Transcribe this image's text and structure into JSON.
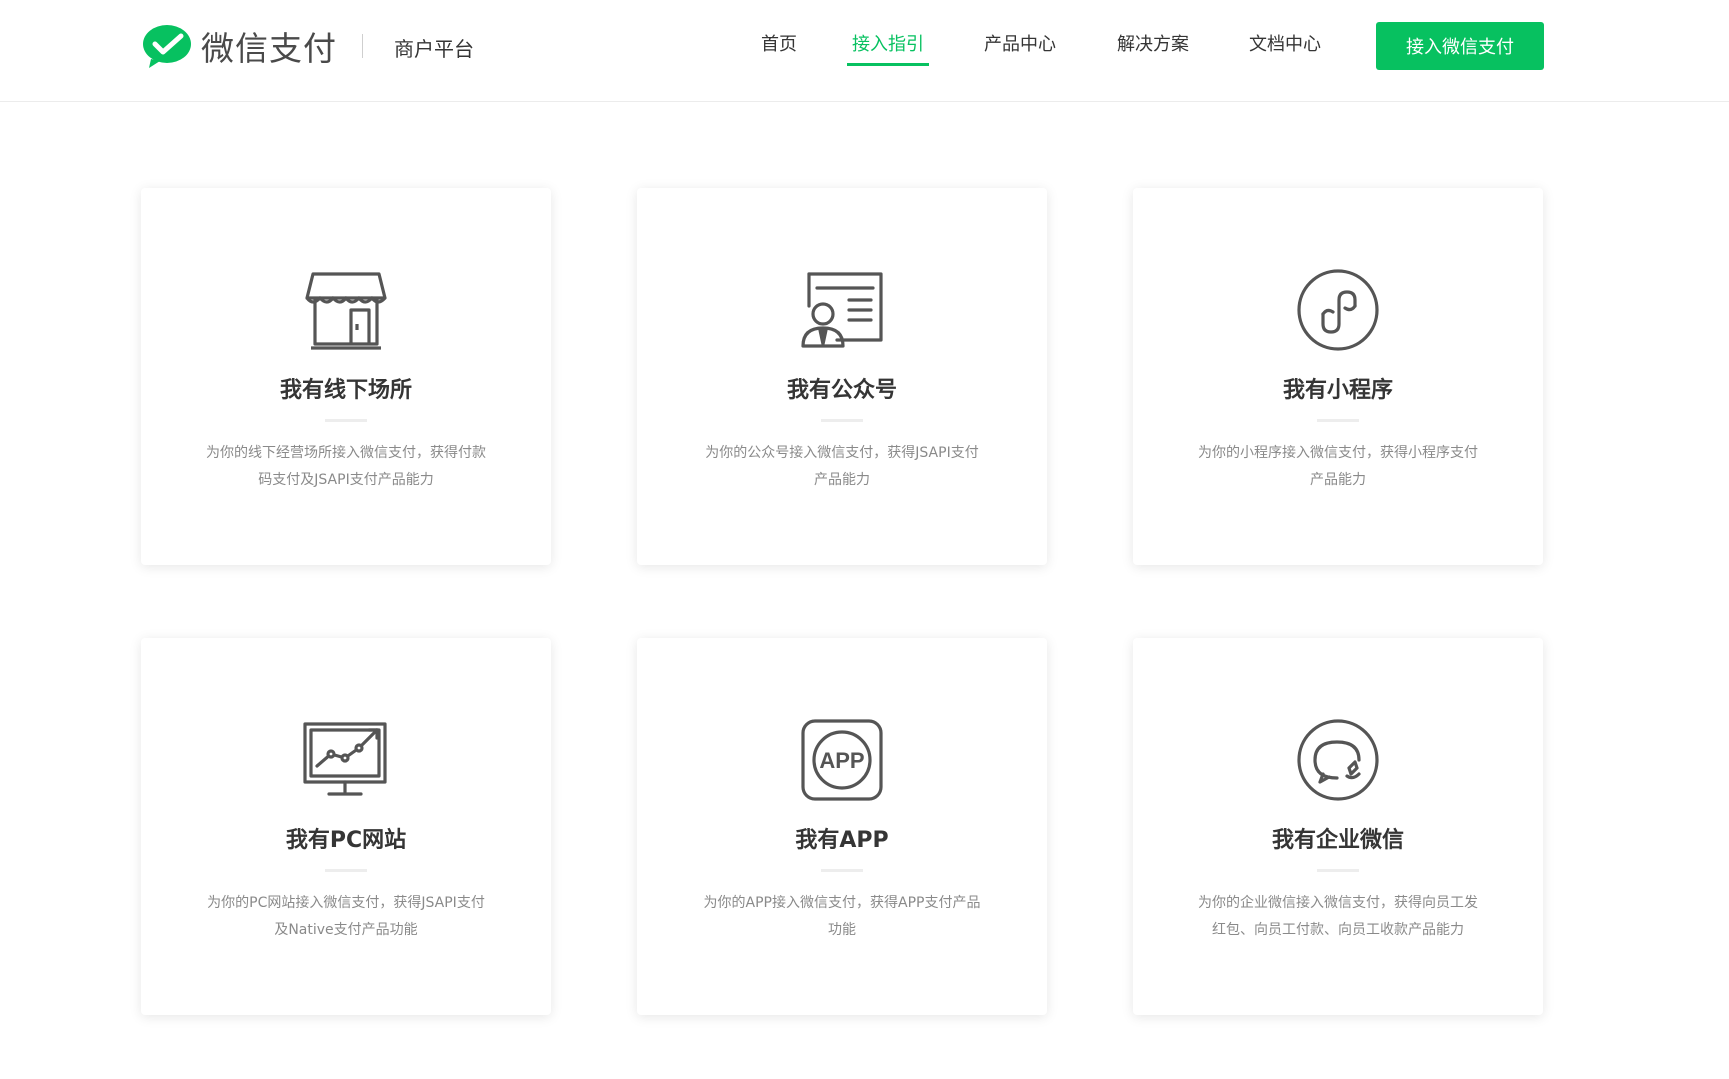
{
  "header": {
    "brand_name": "微信支付",
    "brand_sub": "商户平台",
    "nav": [
      {
        "label": "首页",
        "active": false
      },
      {
        "label": "接入指引",
        "active": true
      },
      {
        "label": "产品中心",
        "active": false
      },
      {
        "label": "解决方案",
        "active": false
      },
      {
        "label": "文档中心",
        "active": false
      }
    ],
    "cta_label": "接入微信支付"
  },
  "cards": [
    {
      "icon": "storefront-icon",
      "title": "我有线下场所",
      "desc": "为你的线下经营场所接入微信支付，获得付款码支付及JSAPI支付产品能力"
    },
    {
      "icon": "official-account-icon",
      "title": "我有公众号",
      "desc": "为你的公众号接入微信支付，获得JSAPI支付产品能力"
    },
    {
      "icon": "mini-program-icon",
      "title": "我有小程序",
      "desc": "为你的小程序接入微信支付，获得小程序支付产品能力"
    },
    {
      "icon": "pc-website-icon",
      "title": "我有PC网站",
      "desc": "为你的PC网站接入微信支付，获得JSAPI支付及Native支付产品功能"
    },
    {
      "icon": "app-icon",
      "title": "我有APP",
      "icon_text": "APP",
      "desc": "为你的APP接入微信支付，获得APP支付产品功能"
    },
    {
      "icon": "wecom-icon",
      "title": "我有企业微信",
      "desc": "为你的企业微信接入微信支付，获得向员工发红包、向员工付款、向员工收款产品能力"
    }
  ],
  "colors": {
    "accent": "#07c160",
    "text": "#353535",
    "desc": "#8a8a8a",
    "icon": "#555555"
  }
}
